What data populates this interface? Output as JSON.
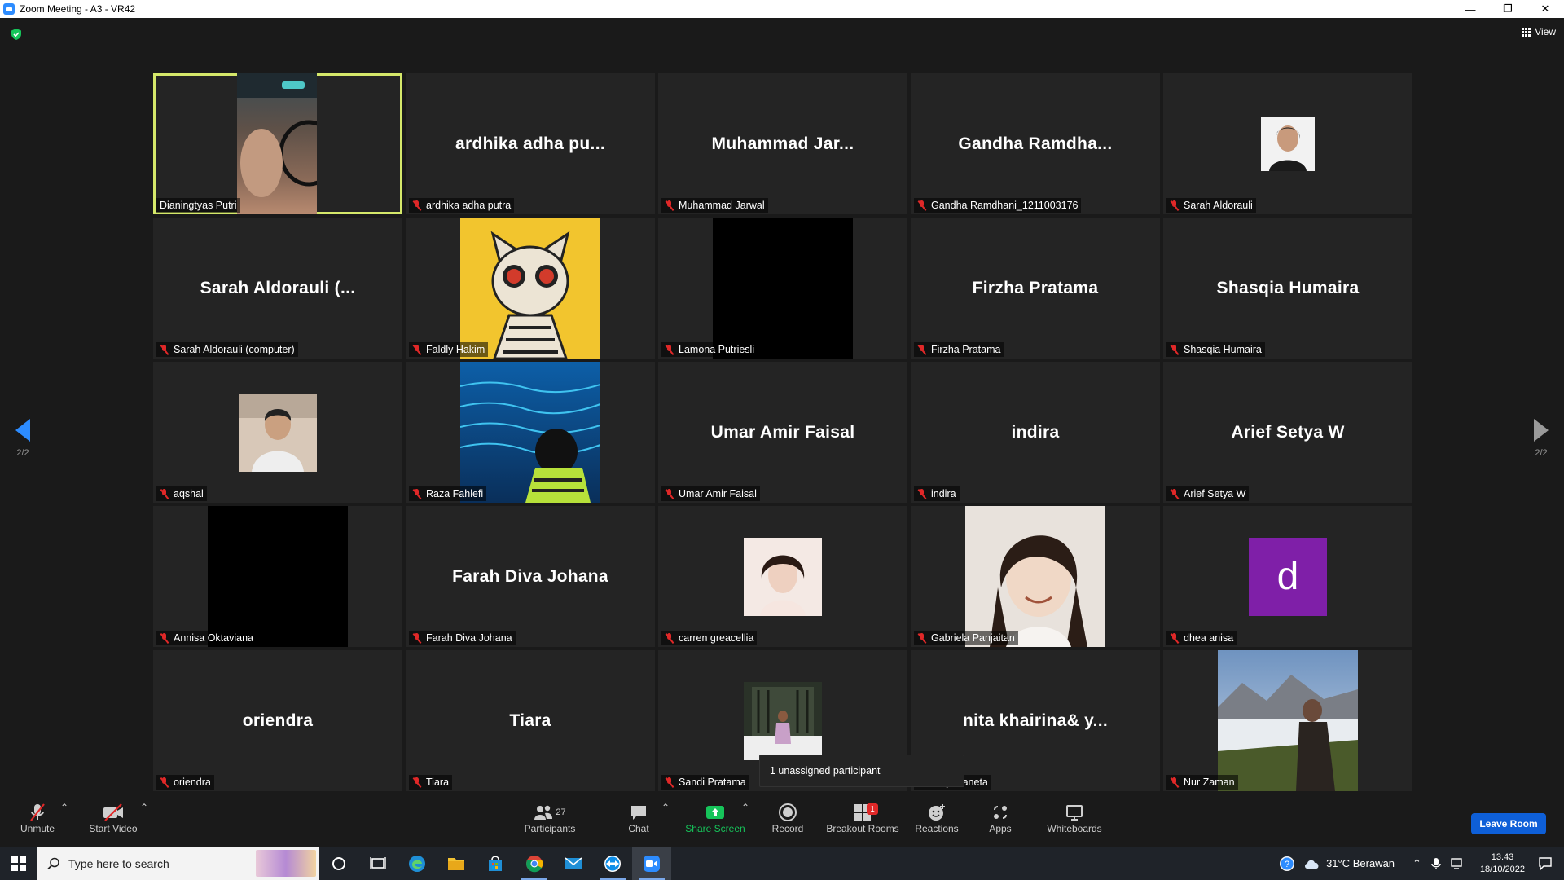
{
  "window": {
    "title": "Zoom Meeting - A3 - VR42",
    "minimize": "—",
    "maximize": "❐",
    "close": "✕"
  },
  "top_bar": {
    "view_label": "View"
  },
  "pagination": {
    "prev_page": "2/2",
    "next_page": "2/2"
  },
  "tiles": [
    {
      "name": "Dianingtyas Putri",
      "big_name": "",
      "muted": false,
      "active": true,
      "media": "video"
    },
    {
      "name": "ardhika adha putra",
      "big_name": "ardhika adha pu...",
      "muted": true,
      "media": "none"
    },
    {
      "name": "Muhammad Jarwal",
      "big_name": "Muhammad Jar...",
      "muted": true,
      "media": "none"
    },
    {
      "name": "Gandha Ramdhani_1211003176",
      "big_name": "Gandha Ramdha...",
      "muted": true,
      "media": "none"
    },
    {
      "name": "Sarah Aldorauli",
      "big_name": "",
      "muted": true,
      "media": "profile-photo"
    },
    {
      "name": "Sarah Aldorauli (computer)",
      "big_name": "Sarah Aldorauli (...",
      "muted": true,
      "media": "none"
    },
    {
      "name": "Faldly Hakim",
      "big_name": "",
      "muted": true,
      "media": "video"
    },
    {
      "name": "Lamona Putriesli",
      "big_name": "",
      "muted": true,
      "media": "video"
    },
    {
      "name": "Firzha Pratama",
      "big_name": "Firzha Pratama",
      "muted": true,
      "media": "none"
    },
    {
      "name": "Shasqia Humaira",
      "big_name": "Shasqia Humaira",
      "muted": true,
      "media": "none"
    },
    {
      "name": "aqshal",
      "big_name": "",
      "muted": true,
      "media": "profile-photo"
    },
    {
      "name": "Raza Fahlefi",
      "big_name": "",
      "muted": true,
      "media": "video"
    },
    {
      "name": "Umar Amir Faisal",
      "big_name": "Umar Amir Faisal",
      "muted": true,
      "media": "none"
    },
    {
      "name": "indira",
      "big_name": "indira",
      "muted": true,
      "media": "none"
    },
    {
      "name": "Arief Setya W",
      "big_name": "Arief Setya W",
      "muted": true,
      "media": "none"
    },
    {
      "name": "Annisa Oktaviana",
      "big_name": "",
      "muted": true,
      "media": "video"
    },
    {
      "name": "Farah Diva Johana",
      "big_name": "Farah Diva Johana",
      "muted": true,
      "media": "none"
    },
    {
      "name": "carren greacellia",
      "big_name": "",
      "muted": true,
      "media": "profile-photo"
    },
    {
      "name": "Gabriela Panjaitan",
      "big_name": "",
      "muted": true,
      "media": "video"
    },
    {
      "name": "dhea anisa",
      "big_name": "",
      "muted": true,
      "media": "letter-avatar",
      "letter": "d"
    },
    {
      "name": "oriendra",
      "big_name": "oriendra",
      "muted": true,
      "media": "none"
    },
    {
      "name": "Tiara",
      "big_name": "Tiara",
      "muted": true,
      "media": "none"
    },
    {
      "name": "Sandi Pratama",
      "big_name": "",
      "muted": true,
      "media": "profile-photo"
    },
    {
      "name": "irina& yohaneta",
      "big_name": "nita khairina& y...",
      "muted": true,
      "media": "none"
    },
    {
      "name": "Nur Zaman",
      "big_name": "",
      "muted": true,
      "media": "video"
    }
  ],
  "tooltip": {
    "text": "1 unassigned participant"
  },
  "toolbar": {
    "unmute": "Unmute",
    "start_video": "Start Video",
    "participants": "Participants",
    "participants_count": "27",
    "chat": "Chat",
    "share_screen": "Share Screen",
    "record": "Record",
    "breakout_rooms": "Breakout Rooms",
    "breakout_badge": "1",
    "reactions": "Reactions",
    "apps": "Apps",
    "whiteboards": "Whiteboards",
    "leave_room": "Leave Room"
  },
  "taskbar": {
    "search_placeholder": "Type here to search",
    "weather": "31°C  Berawan",
    "time": "13.43",
    "date": "18/10/2022"
  },
  "colors": {
    "active_speaker": "#d5e86a",
    "muted_icon": "#e02828",
    "share_green": "#16c45a",
    "leave_blue": "#0e5fd8",
    "letter_avatar": "#7f1fa8",
    "zoom_blue": "#2d8cff"
  }
}
